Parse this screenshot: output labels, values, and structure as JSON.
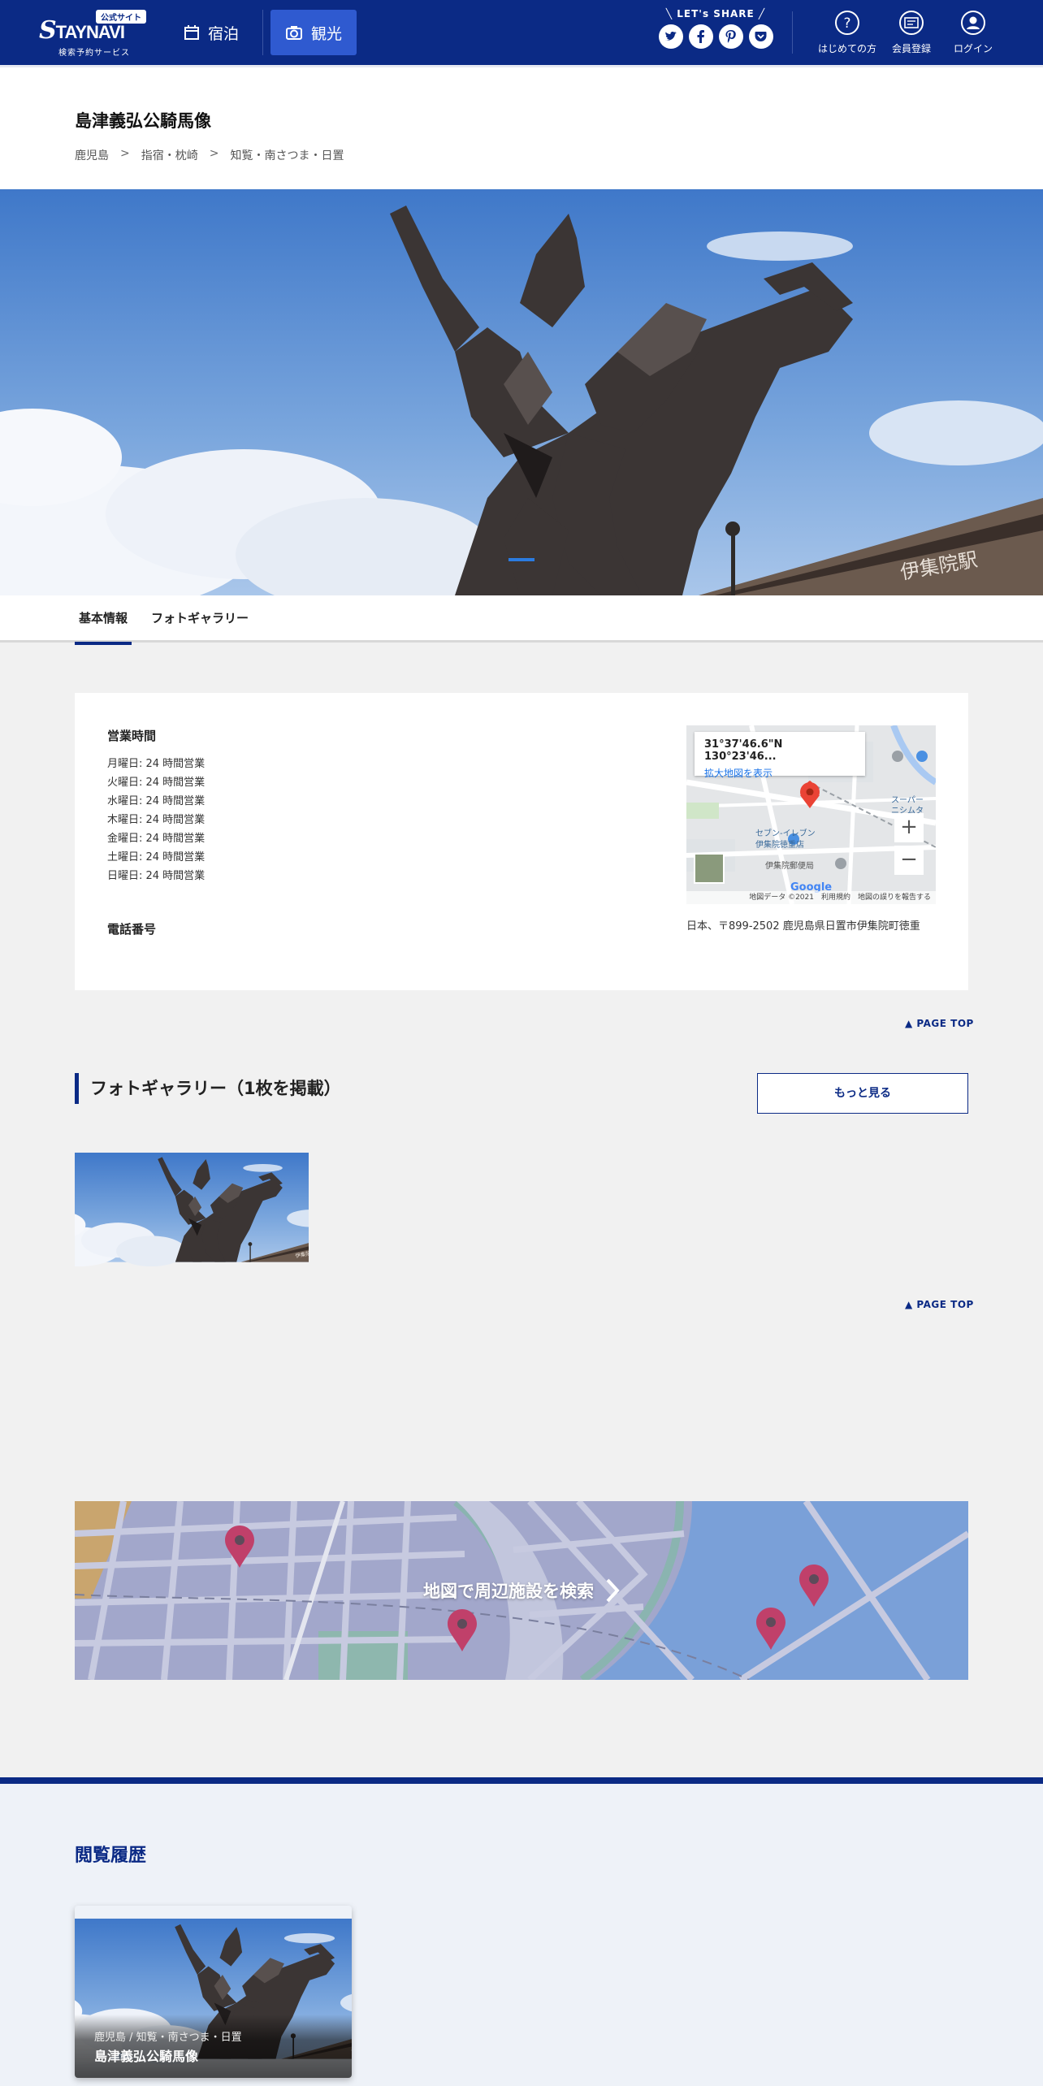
{
  "header": {
    "logo_badge": "公式サイト",
    "logo_text_s": "S",
    "logo_text_rest": "TAYNAVI",
    "logo_sub": "検索予約サービス",
    "nav": [
      {
        "label": "宿泊",
        "icon": "calendar-icon"
      },
      {
        "label": "観光",
        "icon": "camera-icon"
      }
    ],
    "share_label": "LET's SHARE",
    "share_icons": [
      "twitter-icon",
      "facebook-icon",
      "pinterest-icon",
      "pocket-icon"
    ],
    "buttons": [
      {
        "label": "はじめての方",
        "icon": "question-icon"
      },
      {
        "label": "会員登録",
        "icon": "member-card-icon"
      },
      {
        "label": "ログイン",
        "icon": "user-icon"
      }
    ]
  },
  "page": {
    "title": "島津義弘公騎馬像",
    "breadcrumbs": [
      "鹿児島",
      "指宿・枕崎",
      "知覧・南さつま・日置"
    ],
    "breadcrumb_sep": ">"
  },
  "tabs": [
    {
      "label": "基本情報",
      "active": true
    },
    {
      "label": "フォトギャラリー",
      "active": false
    }
  ],
  "info": {
    "hours_heading": "営業時間",
    "hours": [
      "月曜日: 24 時間営業",
      "火曜日: 24 時間営業",
      "水曜日: 24 時間営業",
      "木曜日: 24 時間営業",
      "金曜日: 24 時間営業",
      "土曜日: 24 時間営業",
      "日曜日: 24 時間営業"
    ],
    "phone_heading": "電話番号",
    "map": {
      "coord": "31°37'46.6\"N 130°23'46...",
      "link": "拡大地図を表示",
      "zoom_in": "+",
      "zoom_out": "−",
      "footer": "地図データ ©2021　利用規約　地図の誤りを報告する",
      "labels": [
        "セブン-イレブン",
        "伊集院徳重店",
        "伊集院郵便局",
        "スーパー",
        "ニシムタ"
      ]
    },
    "address": "日本、〒899-2502 鹿児島県日置市伊集院町徳重"
  },
  "page_top": "PAGE TOP",
  "gallery": {
    "title": "フォトギャラリー（1枚を掲載）",
    "more": "もっと見る"
  },
  "map_banner": {
    "cta": "地図で周辺施設を検索"
  },
  "history": {
    "title": "閲覧履歴",
    "items": [
      {
        "area": "鹿児島 / 知覧・南さつま・日置",
        "name": "島津義弘公騎馬像"
      }
    ]
  },
  "colors": {
    "brand": "#0b2a85",
    "accent": "#2f5ad0",
    "pin": "#c0406a"
  }
}
